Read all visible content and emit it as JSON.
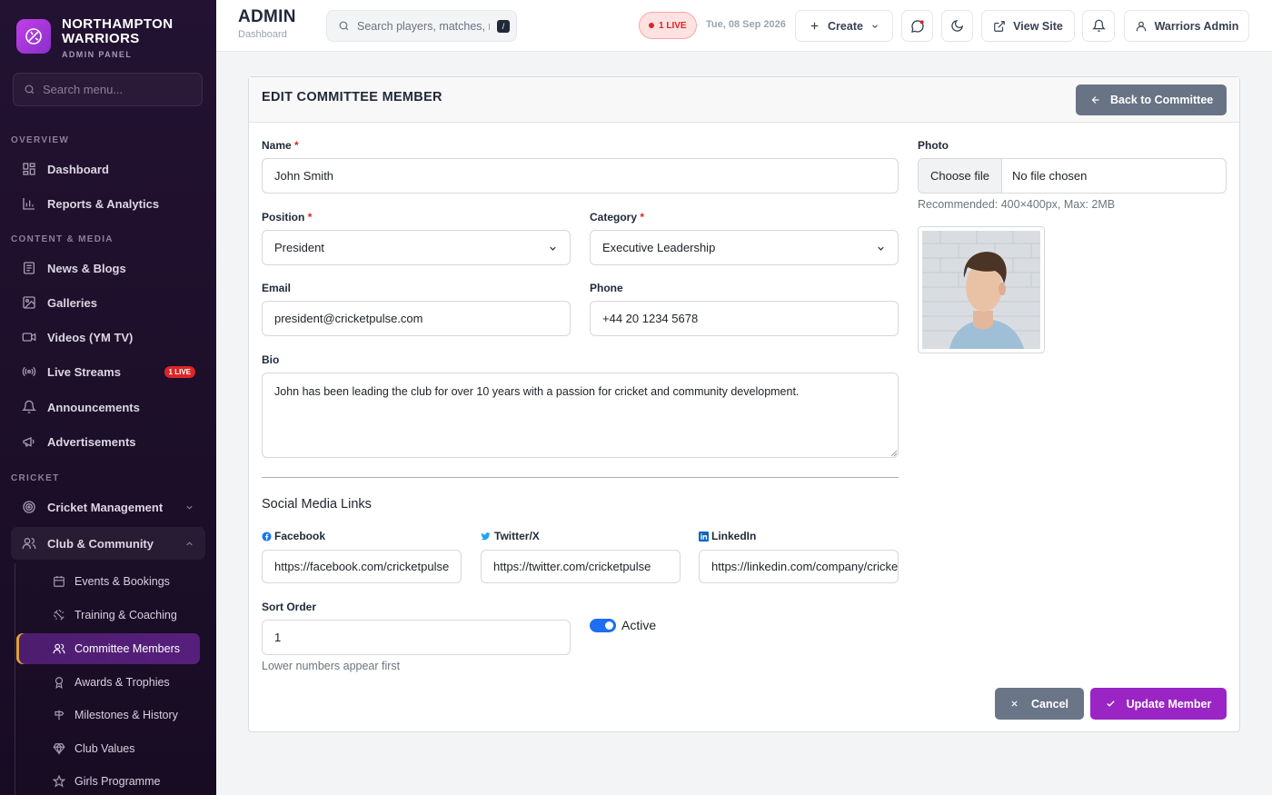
{
  "brand": {
    "name_line1": "NORTHAMPTON",
    "name_line2": "WARRIORS",
    "subtitle": "ADMIN PANEL"
  },
  "sidebar": {
    "search_placeholder": "Search menu...",
    "sections": {
      "overview": "OVERVIEW",
      "content": "CONTENT & MEDIA",
      "cricket": "CRICKET"
    },
    "items": {
      "dashboard": "Dashboard",
      "reports": "Reports & Analytics",
      "news": "News & Blogs",
      "galleries": "Galleries",
      "videos": "Videos (YM TV)",
      "live_streams": "Live Streams",
      "live_badge": "1 LIVE",
      "announcements": "Announcements",
      "advertisements": "Advertisements",
      "cricket_mgmt": "Cricket Management",
      "club_community": "Club & Community"
    },
    "subitems": {
      "events": "Events & Bookings",
      "training": "Training & Coaching",
      "committee": "Committee Members",
      "awards": "Awards & Trophies",
      "milestones": "Milestones & History",
      "values": "Club Values",
      "girls": "Girls Programme"
    }
  },
  "topbar": {
    "title": "ADMIN",
    "subtitle": "Dashboard",
    "search_placeholder": "Search players, matches, r",
    "search_shortcut": "/",
    "live": "1 LIVE",
    "date": "Tue, 08 Sep 2026",
    "create": "Create",
    "view_site": "View Site",
    "user": "Warriors Admin"
  },
  "form": {
    "title": "EDIT COMMITTEE MEMBER",
    "back": "Back to Committee",
    "name_label": "Name",
    "name_value": "John Smith",
    "position_label": "Position",
    "position_value": "President",
    "category_label": "Category",
    "category_value": "Executive Leadership",
    "email_label": "Email",
    "email_value": "president@cricketpulse.com",
    "phone_label": "Phone",
    "phone_value": "+44 20 1234 5678",
    "bio_label": "Bio",
    "bio_value": "John has been leading the club for over 10 years with a passion for cricket and community development.",
    "photo_label": "Photo",
    "choose_file": "Choose file",
    "no_file": "No file chosen",
    "photo_help": "Recommended: 400×400px, Max: 2MB",
    "social_heading": "Social Media Links",
    "facebook_label": "Facebook",
    "facebook_value": "https://facebook.com/cricketpulse",
    "twitter_label": "Twitter/X",
    "twitter_value": "https://twitter.com/cricketpulse",
    "linkedin_label": "LinkedIn",
    "linkedin_value": "https://linkedin.com/company/cricketpulse",
    "sort_label": "Sort Order",
    "sort_value": "1",
    "sort_help": "Lower numbers appear first",
    "active_label": "Active",
    "active": true,
    "cancel": "Cancel",
    "update": "Update Member"
  },
  "colors": {
    "accent": "#9a25c4",
    "sidebar_bg": "#1d0f2a",
    "live": "#dc2626",
    "toggle": "#1d6ef0"
  }
}
